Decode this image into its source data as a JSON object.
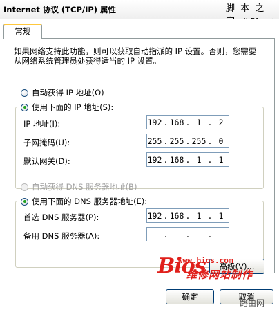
{
  "window": {
    "title": "Internet 协议 (TCP/IP) 属性"
  },
  "watermarks": {
    "top_cn": "脚 本 之 家",
    "top_url": "www.Jb51.net",
    "bios_url": "www.bios.com",
    "bios_cn": "维修网站制作",
    "bios_logo": "Bios",
    "bottom": "路由网"
  },
  "tab": {
    "label": "常规"
  },
  "intro": "如果网络支持此功能，则可以获取自动指派的 IP 设置。否则，您需要从网络系统管理员处获得适当的 IP 设置。",
  "ip_section": {
    "auto_label": "自动获得 IP 地址(O)",
    "manual_label": "使用下面的 IP 地址(S):",
    "manual_selected": true,
    "fields": [
      {
        "label": "IP 地址(I):",
        "value": [
          "192",
          "168",
          "1",
          "2"
        ]
      },
      {
        "label": "子网掩码(U):",
        "value": [
          "255",
          "255",
          "255",
          "0"
        ]
      },
      {
        "label": "默认网关(D):",
        "value": [
          "192",
          "168",
          "1",
          "1"
        ]
      }
    ]
  },
  "dns_section": {
    "auto_label": "自动获得 DNS 服务器地址(B)",
    "manual_label": "使用下面的 DNS 服务器地址(E):",
    "manual_selected": true,
    "fields": [
      {
        "label": "首选 DNS 服务器(P):",
        "value": [
          "192",
          "168",
          "1",
          "1"
        ]
      },
      {
        "label": "备用 DNS 服务器(A):",
        "value": [
          "",
          "",
          "",
          ""
        ]
      }
    ]
  },
  "buttons": {
    "advanced": "高级(V)...",
    "ok": "确定",
    "cancel": "取消"
  }
}
